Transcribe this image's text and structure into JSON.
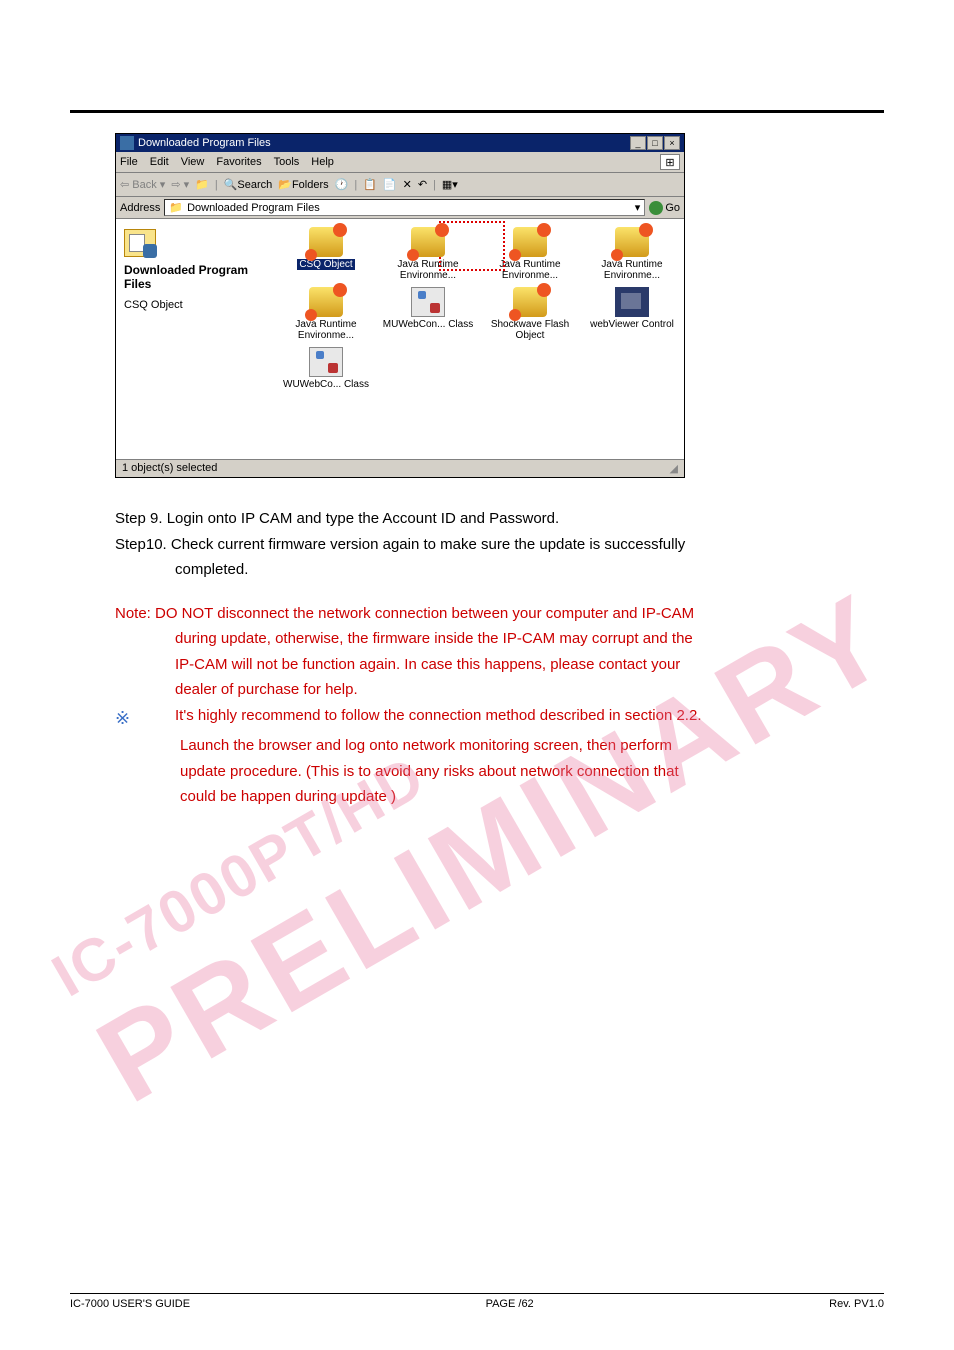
{
  "window": {
    "title": "Downloaded Program Files",
    "menus": [
      "File",
      "Edit",
      "View",
      "Favorites",
      "Tools",
      "Help"
    ],
    "toolbar": {
      "back": "Back",
      "search": "Search",
      "folders": "Folders"
    },
    "address_label": "Address",
    "address_value": "Downloaded Program Files",
    "go": "Go",
    "leftpane_title": "Downloaded Program Files",
    "selected_label": "CSQ Object",
    "items_row1": [
      {
        "label": "CSQ Object",
        "selected": true,
        "icon": "gears"
      },
      {
        "label": "Java Runtime Environme...",
        "icon": "gears"
      },
      {
        "label": "Java Runtime Environme...",
        "icon": "gears"
      },
      {
        "label": "Java Runtime Environme...",
        "icon": "gears"
      },
      {
        "label": "Java Runtime Environme...",
        "icon": "gears"
      }
    ],
    "items_row2": [
      {
        "label": "MUWebCon... Class",
        "icon": "dll"
      },
      {
        "label": "Shockwave Flash Object",
        "icon": "gears"
      },
      {
        "label": "webViewer Control",
        "icon": "webviewer"
      },
      {
        "label": "WUWebCo... Class",
        "icon": "dll"
      }
    ],
    "status": "1 object(s) selected"
  },
  "steps": {
    "s9": "Step 9. Login onto IP CAM and type the Account ID and Password.",
    "s10": "Step10. Check current firmware version again to make sure the update is successfully",
    "s10b": "completed."
  },
  "note": {
    "l1": "Note: DO NOT disconnect the network connection between your computer and IP-CAM",
    "l2": "during update, otherwise, the firmware inside the IP-CAM may corrupt and the",
    "l3": "IP-CAM will not be function again. In case this happens, please contact your",
    "l4": "dealer of purchase for help.",
    "star": "※",
    "s1": "It's highly recommend to follow the connection method described in section 2.2.",
    "s2": "Launch the browser and log onto network monitoring screen, then perform",
    "s3": "update procedure. (This is to avoid any risks about network connection that",
    "s4": "could be happen during update )"
  },
  "watermark": {
    "line1": "IC-7000PT/HD",
    "line2": "PRELIMINARY"
  },
  "footer": {
    "left": "IC-7000 USER'S GUIDE",
    "center": "PAGE   /62",
    "right": "Rev. PV1.0"
  }
}
